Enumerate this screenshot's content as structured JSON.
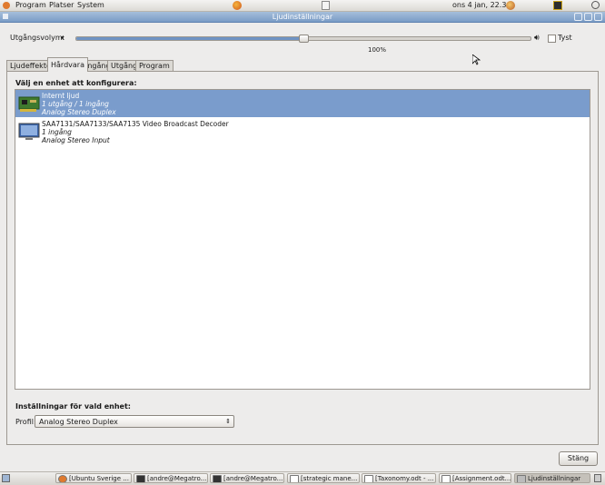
{
  "top_panel": {
    "menu": [
      "Program",
      "Platser",
      "System"
    ],
    "clock": "ons  4 jan, 22.36"
  },
  "window": {
    "title": "Ljudinställningar"
  },
  "volume": {
    "label": "Utgångsvolym:",
    "percent_text": "100%",
    "level": 0.5,
    "mute_label": "Tyst"
  },
  "tabs": [
    {
      "label": "Ljudeffekter"
    },
    {
      "label": "Hårdvara"
    },
    {
      "label": "Ingång"
    },
    {
      "label": "Utgång"
    },
    {
      "label": "Program"
    }
  ],
  "hardware": {
    "device_heading": "Välj en enhet att konfigurera:",
    "devices": [
      {
        "name": "Internt ljud",
        "ports": "1 utgång / 1 ingång",
        "profile": "Analog Stereo Duplex"
      },
      {
        "name": "SAA7131/SAA7133/SAA7135 Video Broadcast Decoder",
        "ports": "1 ingång",
        "profile": "Analog Stereo Input"
      }
    ],
    "settings_heading": "Inställningar för vald enhet:",
    "profile_label": "Profil:",
    "profile_value": "Analog Stereo Duplex"
  },
  "buttons": {
    "close": "Stäng"
  },
  "taskbar": [
    {
      "label": "[Ubuntu Sverige ..."
    },
    {
      "label": "[andre@Megatro..."
    },
    {
      "label": "[andre@Megatro..."
    },
    {
      "label": "[strategic mane..."
    },
    {
      "label": "[Taxonomy.odt - ..."
    },
    {
      "label": "[Assignment.odt..."
    },
    {
      "label": "Ljudinställningar"
    }
  ],
  "colors": {
    "selection": "#7a9ccc",
    "titlebar": "#7a9cc6"
  }
}
